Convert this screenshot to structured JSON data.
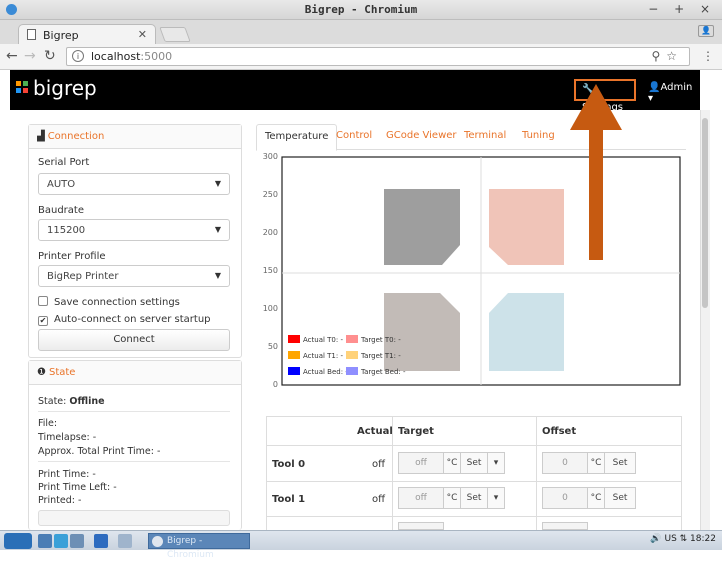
{
  "window": {
    "title": "Bigrep - Chromium",
    "controls": "− + ×"
  },
  "browser": {
    "tab_title": "Bigrep",
    "url_host": "localhost",
    "url_port": ":5000"
  },
  "navbar": {
    "brand": "bigrep",
    "settings_label": "Settings",
    "admin_label": "Admin"
  },
  "connection": {
    "title": "Connection",
    "serial_port_label": "Serial Port",
    "serial_port_value": "AUTO",
    "baudrate_label": "Baudrate",
    "baudrate_value": "115200",
    "profile_label": "Printer Profile",
    "profile_value": "BigRep Printer",
    "save_settings_label": "Save connection settings",
    "save_settings_checked": false,
    "autoconnect_label": "Auto-connect on server startup",
    "autoconnect_checked": true,
    "connect_button": "Connect"
  },
  "state": {
    "title": "State",
    "state_label": "State:",
    "state_value": "Offline",
    "file_label": "File:",
    "timelapse": "Timelapse: -",
    "approx_total": "Approx. Total Print Time: -",
    "print_time": "Print Time: -",
    "print_time_left": "Print Time Left: -",
    "printed": "Printed: -"
  },
  "tabs": [
    {
      "label": "Temperature",
      "active": true
    },
    {
      "label": "Control",
      "active": false
    },
    {
      "label": "GCode Viewer",
      "active": false
    },
    {
      "label": "Terminal",
      "active": false
    },
    {
      "label": "Tuning",
      "active": false
    }
  ],
  "chart_data": {
    "type": "line",
    "title": "",
    "xlabel": "",
    "ylabel": "",
    "ylim": [
      0,
      300
    ],
    "yticks": [
      "300",
      "250",
      "200",
      "150",
      "100",
      "50",
      "0"
    ],
    "series": [
      {
        "name": "Actual T0: -",
        "color": "#ff0000",
        "values": []
      },
      {
        "name": "Target T0: -",
        "color": "#ff8f8f",
        "values": []
      },
      {
        "name": "Actual T1: -",
        "color": "#ffa500",
        "values": []
      },
      {
        "name": "Target T1: -",
        "color": "#ffd27a",
        "values": []
      },
      {
        "name": "Actual Bed: -",
        "color": "#0000ff",
        "values": []
      },
      {
        "name": "Target Bed: -",
        "color": "#8f8fff",
        "values": []
      }
    ],
    "legend": "bottom-left"
  },
  "tool_table": {
    "headers": {
      "actual": "Actual",
      "target": "Target",
      "offset": "Offset"
    },
    "rows": [
      {
        "label": "Tool 0",
        "actual": "off",
        "target": "off",
        "unit": "°C",
        "set": "Set",
        "offset": "0"
      },
      {
        "label": "Tool 1",
        "actual": "off",
        "target": "off",
        "unit": "°C",
        "set": "Set",
        "offset": "0"
      }
    ]
  },
  "taskbar": {
    "task_label": "Bigrep - Chromium",
    "tray_text": "🔊 US  ⇅ 18:22"
  }
}
